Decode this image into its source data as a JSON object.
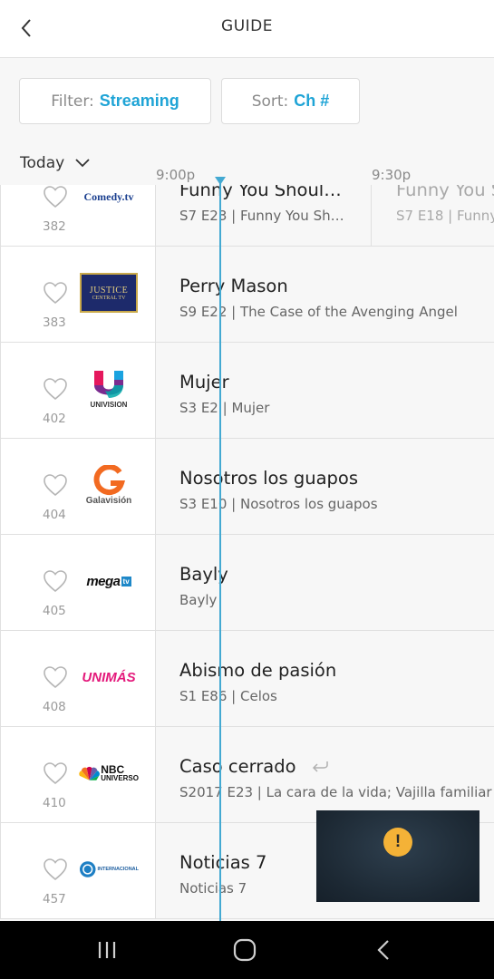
{
  "header": {
    "title": "GUIDE"
  },
  "controls": {
    "filter_label": "Filter:",
    "filter_value": "Streaming",
    "sort_label": "Sort:",
    "sort_value": "Ch #",
    "day": "Today"
  },
  "timeline": {
    "slots": [
      "9:00p",
      "9:30p"
    ]
  },
  "channels": [
    {
      "number": "382",
      "logo": "Comedy.tv",
      "logo_icon": "comedytv-logo",
      "title": "Funny You Shoul…",
      "subtitle": "S7 E23 | Funny You Sh…",
      "next_title": "Funny You S",
      "next_subtitle": "S7 E18 | Funny"
    },
    {
      "number": "383",
      "logo": "JUSTICE",
      "logo_sub": "CENTRAL TV",
      "logo_icon": "justice-central-logo",
      "title": "Perry Mason",
      "subtitle": "S9 E22 | The Case of the Avenging Angel"
    },
    {
      "number": "402",
      "logo": "UNIVISION",
      "logo_icon": "univision-logo",
      "title": "Mujer",
      "subtitle": "S3 E2 | Mujer"
    },
    {
      "number": "404",
      "logo": "Galavisión",
      "logo_icon": "galavision-logo",
      "title": "Nosotros los guapos",
      "subtitle": "S3 E10 | Nosotros los guapos"
    },
    {
      "number": "405",
      "logo": "mega",
      "logo_suffix": "tv",
      "logo_icon": "megatv-logo",
      "title": "Bayly",
      "subtitle": "Bayly"
    },
    {
      "number": "408",
      "logo": "UNIMÁS",
      "logo_icon": "unimas-logo",
      "title": "Abismo de pasión",
      "subtitle": "S1 E86 | Celos"
    },
    {
      "number": "410",
      "logo": "NBC",
      "logo_sub": "UNIVERSO",
      "logo_icon": "nbc-universo-logo",
      "title": "Caso cerrado",
      "subtitle": "S2017 E23 | La cara de la vida; Vajilla familiar"
    },
    {
      "number": "457",
      "logo": "INTERNACIONAL",
      "logo_icon": "tc-internacional-logo",
      "title": "Noticias 7",
      "subtitle": "Noticias 7"
    }
  ],
  "player": {
    "warning": "!"
  },
  "colors": {
    "accent": "#1fa4d6",
    "now_line": "#43a9d2",
    "warning": "#f4b237",
    "unimas": "#e4197b"
  }
}
